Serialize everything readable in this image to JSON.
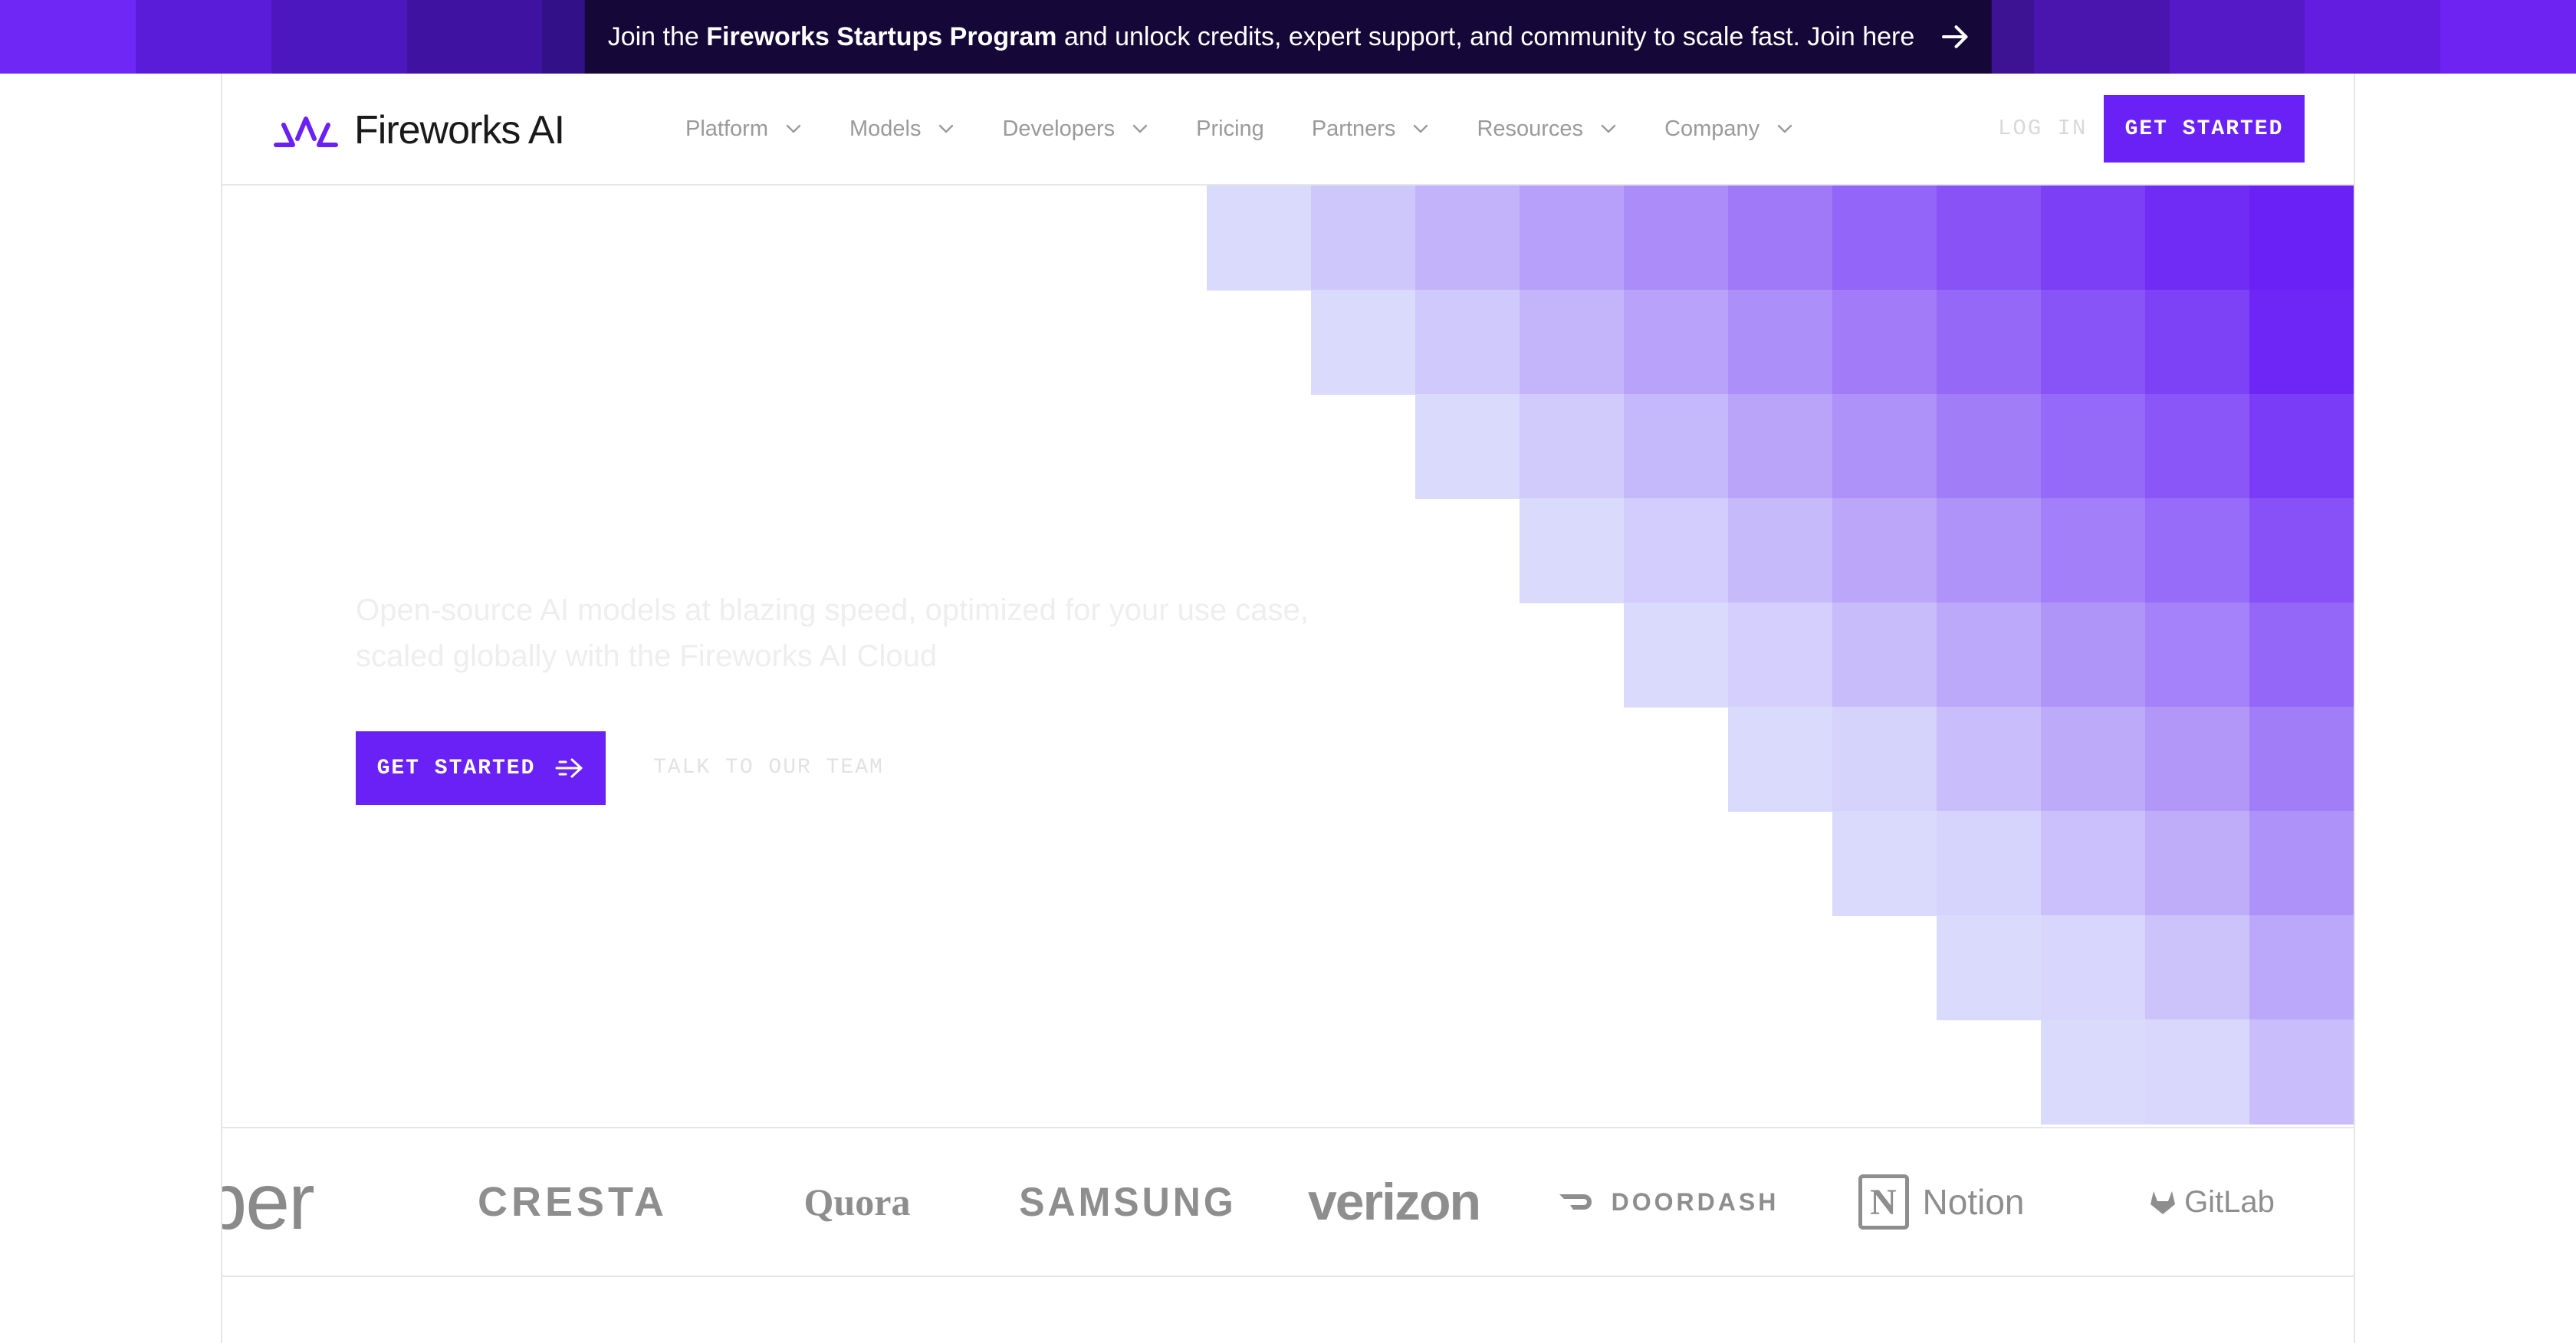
{
  "banner": {
    "prefix": "Join the ",
    "program": "Fireworks Startups Program",
    "suffix": " and unlock credits, expert support, and community to scale fast. Join here",
    "colors": [
      "#6f27f6",
      "#5b1cd9",
      "#4d17bf",
      "#3f12a2",
      "#321087",
      "#2a0d72",
      "#230b5e",
      "#1d0a4f",
      "#1a0946",
      "#1b0a48",
      "#1e0b4e",
      "#230c59",
      "#2a0e68",
      "#33107c",
      "#3d1394",
      "#4915ae",
      "#5619c7",
      "#631de0",
      "#6e23f3"
    ]
  },
  "header": {
    "brand": "Fireworks AI",
    "nav": [
      {
        "label": "Platform",
        "dropdown": true
      },
      {
        "label": "Models",
        "dropdown": true
      },
      {
        "label": "Developers",
        "dropdown": true
      },
      {
        "label": "Pricing",
        "dropdown": false
      },
      {
        "label": "Partners",
        "dropdown": true
      },
      {
        "label": "Resources",
        "dropdown": true
      },
      {
        "label": "Company",
        "dropdown": true
      }
    ],
    "login": "LOG IN",
    "cta": "GET STARTED"
  },
  "hero": {
    "subtitle": "Open-source AI models at blazing speed, optimized for your use case, scaled globally with the Fireworks AI Cloud",
    "primary_cta": "GET STARTED",
    "secondary_cta": "TALK TO OUR TEAM"
  },
  "clients": {
    "uber": "Uber",
    "cresta": "CRESTA",
    "quora": "Quora",
    "samsung": "SAMSUNG",
    "verizon": "verizon",
    "doordash": "DOORDASH",
    "notion": "Notion",
    "notion_mark": "N",
    "gitlab": "GitLab"
  },
  "colors": {
    "accent": "#6a21f5",
    "mosaic_light": "#dadafc",
    "mosaic_dark": "#6a21f5"
  }
}
